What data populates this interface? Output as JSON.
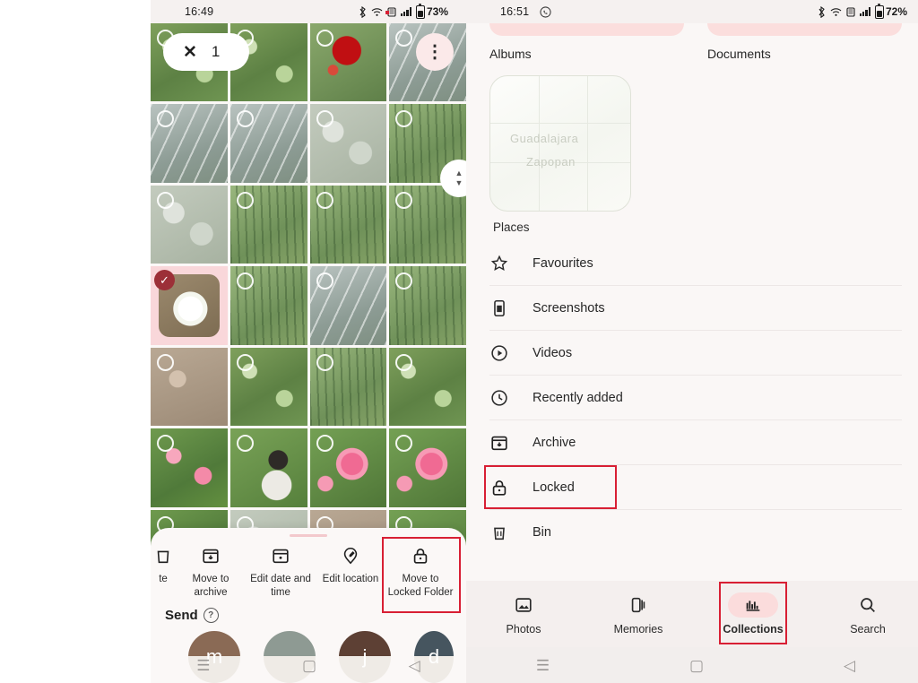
{
  "left_phone": {
    "status_bar": {
      "time": "16:49",
      "battery": "73%",
      "icons": [
        "bluetooth-icon",
        "wifi-icon",
        "sim-icon",
        "signal-icon",
        "battery-icon"
      ]
    },
    "selection_bar": {
      "close_icon": "close-icon",
      "count": "1",
      "overflow_icon": "more-vert-icon"
    },
    "scroll_control": {
      "up_icon": "▲",
      "down_icon": "▼"
    },
    "photos": [
      {
        "alt": "greenhouse pond lilypads",
        "tex": "t-green"
      },
      {
        "alt": "greenhouse pond wide",
        "tex": "t-green"
      },
      {
        "alt": "red flower close-up",
        "tex": "t-red"
      },
      {
        "alt": "greenhouse window frame",
        "tex": "t-glass"
      },
      {
        "alt": "cactus along glass wall",
        "tex": "t-glass"
      },
      {
        "alt": "greenhouse interior cacti",
        "tex": "t-glass"
      },
      {
        "alt": "round grey cacti with label",
        "tex": "t-stone"
      },
      {
        "alt": "dense cactus bed",
        "tex": "t-cactus"
      },
      {
        "alt": "white cacti cluster",
        "tex": "t-stone"
      },
      {
        "alt": "tall green cacti",
        "tex": "t-cactus"
      },
      {
        "alt": "cactus bed greenhouse",
        "tex": "t-cactus"
      },
      {
        "alt": "cactus with white bloom",
        "tex": "t-cactus"
      },
      {
        "alt": "white cactus flower",
        "tex": "t-flower",
        "selected": true
      },
      {
        "alt": "cactus garden",
        "tex": "t-cactus"
      },
      {
        "alt": "greenhouse roof cacti",
        "tex": "t-glass"
      },
      {
        "alt": "spiky palm leaves",
        "tex": "t-cactus"
      },
      {
        "alt": "stone succulents",
        "tex": "t-ground"
      },
      {
        "alt": "green leafy plants",
        "tex": "t-green"
      },
      {
        "alt": "tall cactus column",
        "tex": "t-cactus"
      },
      {
        "alt": "garden lawn view",
        "tex": "t-green"
      },
      {
        "alt": "pink blossom meadow",
        "tex": "t-pink"
      },
      {
        "alt": "person in flower field",
        "tex": "t-person"
      },
      {
        "alt": "pink roses",
        "tex": "t-rose"
      },
      {
        "alt": "pink rose bush",
        "tex": "t-rose"
      },
      {
        "alt": "flower bed partial",
        "tex": "t-pink"
      },
      {
        "alt": "grey path partial",
        "tex": "t-stone"
      },
      {
        "alt": "brown soil partial",
        "tex": "t-ground"
      },
      {
        "alt": "pink flowers partial",
        "tex": "t-rose"
      }
    ],
    "action_sheet": {
      "items": [
        {
          "label": "te",
          "icon": "delete-icon",
          "clipped": true
        },
        {
          "label": "Move to archive",
          "icon": "archive-icon"
        },
        {
          "label": "Edit date and time",
          "icon": "calendar-icon"
        },
        {
          "label": "Edit location",
          "icon": "location-edit-icon"
        },
        {
          "label": "Move to Locked Folder",
          "icon": "lock-icon",
          "highlighted": true
        }
      ],
      "send": {
        "label": "Send",
        "help_icon": "help-icon"
      },
      "avatars": [
        {
          "letter": "m",
          "color": "#8a6a55"
        },
        {
          "letter": "",
          "color": "#8e9a93"
        },
        {
          "letter": "j",
          "color": "#5d4034"
        },
        {
          "letter": "d",
          "color": "#46555f"
        }
      ]
    },
    "nav_bar": {
      "recents_icon": "recents-icon",
      "home_icon": "home-icon",
      "back_icon": "back-icon"
    }
  },
  "right_phone": {
    "status_bar": {
      "time": "16:51",
      "whatsapp_icon": "whatsapp-icon",
      "battery": "72%"
    },
    "card_tabs": [
      {
        "label": "Albums"
      },
      {
        "label": "Documents"
      }
    ],
    "places": {
      "caption": "Places",
      "map_labels": [
        "Guadalajara",
        "Zapopan"
      ]
    },
    "menu_items": [
      {
        "label": "Favourites",
        "icon": "star-icon"
      },
      {
        "label": "Screenshots",
        "icon": "screenshot-icon"
      },
      {
        "label": "Videos",
        "icon": "play-circle-icon"
      },
      {
        "label": "Recently added",
        "icon": "clock-icon"
      },
      {
        "label": "Archive",
        "icon": "archive-icon"
      },
      {
        "label": "Locked",
        "icon": "lock-icon",
        "highlighted": true
      },
      {
        "label": "Bin",
        "icon": "trash-icon"
      }
    ],
    "bottom_nav": [
      {
        "label": "Photos",
        "icon": "photos-icon",
        "active": false
      },
      {
        "label": "Memories",
        "icon": "memories-icon",
        "active": false
      },
      {
        "label": "Collections",
        "icon": "collections-icon",
        "active": true,
        "highlighted": true
      },
      {
        "label": "Search",
        "icon": "search-icon",
        "active": false
      }
    ],
    "nav_bar": {
      "recents_icon": "recents-icon",
      "home_icon": "home-icon",
      "back_icon": "back-icon"
    }
  },
  "annotation_color": "#d81f34"
}
